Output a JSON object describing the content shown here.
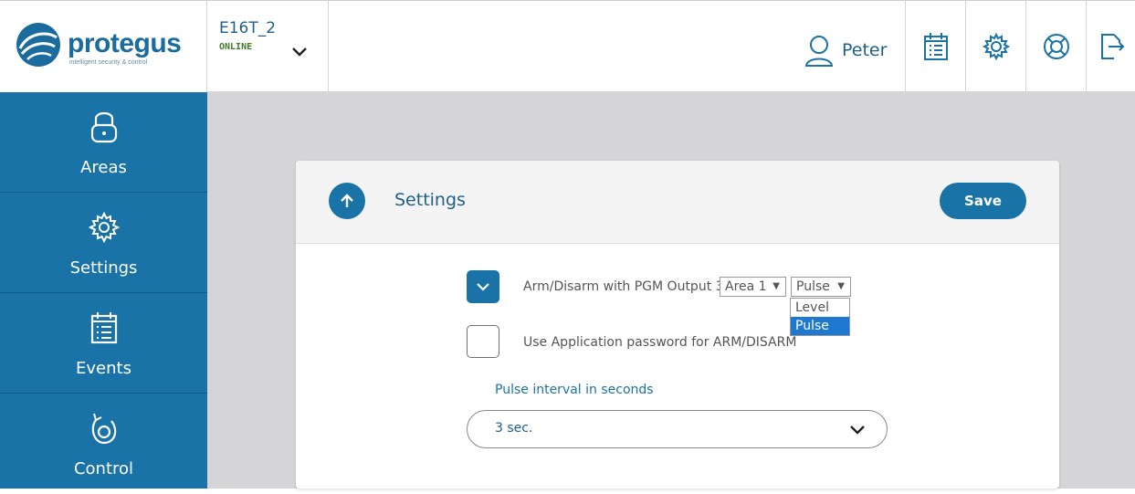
{
  "brand": {
    "name": "protegus",
    "tagline": "intelligent security & control",
    "color": "#1a6b9e"
  },
  "device": {
    "name": "E16T_2",
    "status": "ONLINE",
    "status_color": "#3f7a2a"
  },
  "user": {
    "name": "Peter"
  },
  "header_actions": [
    {
      "icon": "calendar-list-icon"
    },
    {
      "icon": "gear-icon"
    },
    {
      "icon": "lifebuoy-icon"
    },
    {
      "icon": "logout-icon"
    }
  ],
  "sidebar": {
    "accent": "#1a73a6",
    "items": [
      {
        "label": "Areas",
        "icon": "lock-icon"
      },
      {
        "label": "Settings",
        "icon": "gear-icon"
      },
      {
        "label": "Events",
        "icon": "calendar-list-icon"
      },
      {
        "label": "Control",
        "icon": "control-icon"
      }
    ]
  },
  "card": {
    "title": "Settings",
    "save_label": "Save",
    "arm_option": {
      "checked": true,
      "label": "Arm/Disarm with PGM Output 3",
      "area_value": "Area 1",
      "mode_value": "Pulse",
      "mode_options": [
        "Level",
        "Pulse"
      ]
    },
    "password_option": {
      "checked": false,
      "label": "Use Application password for ARM/DISARM"
    },
    "pulse": {
      "label": "Pulse interval in seconds",
      "value": "3 sec."
    }
  }
}
